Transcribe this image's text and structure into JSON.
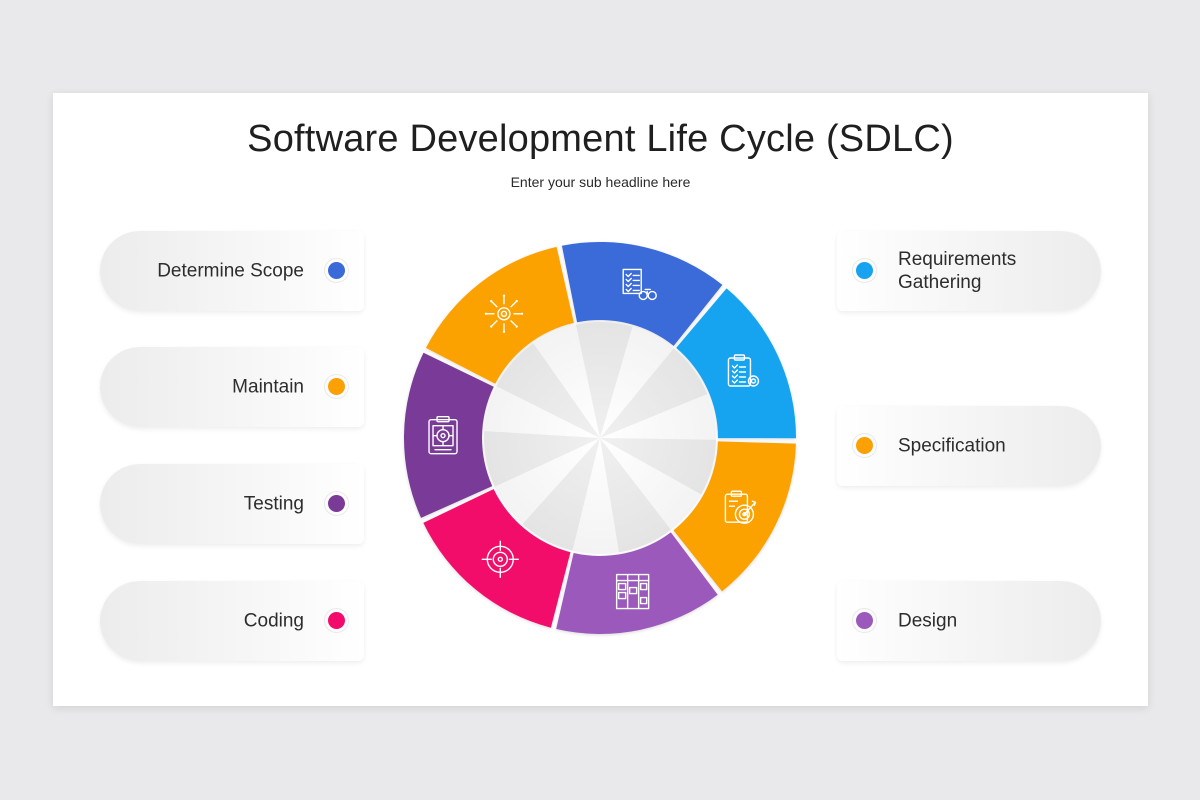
{
  "title": "Software Development Life Cycle (SDLC)",
  "subtitle": "Enter your sub headline here",
  "colors": {
    "blue": "#3a6ad9",
    "cyan": "#17a3f0",
    "orange": "#fba106",
    "purple_light": "#9b5abb",
    "pink": "#f30b6b",
    "purple_dark": "#7a3a98"
  },
  "left_items": [
    {
      "label": "Determine Scope",
      "color": "#3a6ad9"
    },
    {
      "label": "Maintain",
      "color": "#fba106"
    },
    {
      "label": "Testing",
      "color": "#7a3a98"
    },
    {
      "label": "Coding",
      "color": "#f30b6b"
    }
  ],
  "right_items": [
    {
      "label": "Requirements Gathering",
      "color": "#17a3f0"
    },
    {
      "label": "Specification",
      "color": "#fba106"
    },
    {
      "label": "Design",
      "color": "#9b5abb"
    }
  ],
  "wheel_segments": [
    {
      "name": "determine-scope",
      "color": "#3a6ad9",
      "icon": "checklist-binoculars-icon"
    },
    {
      "name": "requirements-gathering",
      "color": "#17a3f0",
      "icon": "clipboard-gear-icon"
    },
    {
      "name": "specification",
      "color": "#fba106",
      "icon": "clipboard-target-icon"
    },
    {
      "name": "design",
      "color": "#9b5abb",
      "icon": "kanban-board-icon"
    },
    {
      "name": "coding",
      "color": "#f30b6b",
      "icon": "crosshair-icon"
    },
    {
      "name": "testing",
      "color": "#7a3a98",
      "icon": "target-document-icon"
    },
    {
      "name": "maintain",
      "color": "#fba106",
      "icon": "gear-arrows-icon"
    }
  ]
}
